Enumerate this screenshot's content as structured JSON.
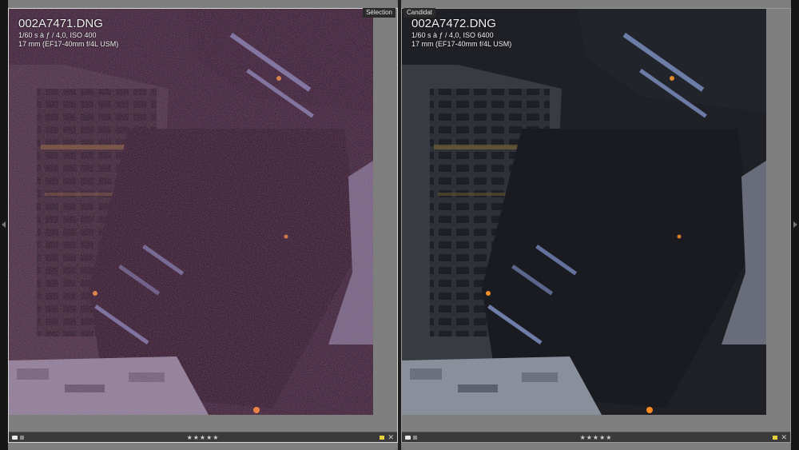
{
  "colors": {
    "background": "#7f7f7f",
    "footer": "#3a3a3a",
    "color_label_yellow": "#e6d23a"
  },
  "panes": {
    "selection": {
      "label": "Sélection",
      "filename": "002A7471.DNG",
      "exposure": "1/60 s à ƒ / 4,0, ISO 400",
      "lens": "17 mm (EF17-40mm f/4L USM)",
      "rating": "★★★★★",
      "close": "✕"
    },
    "candidate": {
      "label": "Candidat",
      "filename": "002A7472.DNG",
      "exposure": "1/60 s à ƒ / 4,0, ISO 6400",
      "lens": "17 mm (EF17-40mm f/4L USM)",
      "rating": "★★★★★",
      "close": "✕"
    }
  },
  "icons": {
    "left_panel_toggle": "triangle-left-icon",
    "right_panel_toggle": "triangle-right-icon",
    "top_panel_toggle": "triangle-down-icon",
    "bottom_panel_toggle": "triangle-up-icon",
    "flag": "flag-icon",
    "close": "close-icon"
  }
}
